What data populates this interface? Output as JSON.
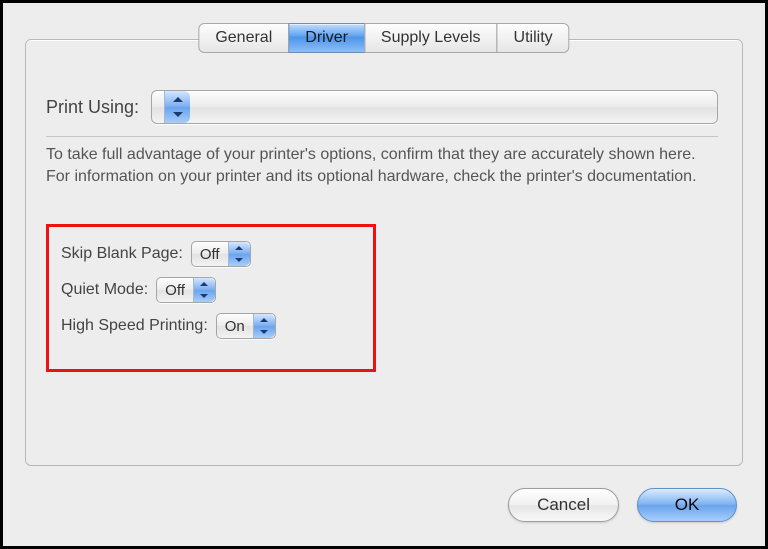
{
  "tabs": [
    {
      "label": "General",
      "active": false
    },
    {
      "label": "Driver",
      "active": true
    },
    {
      "label": "Supply Levels",
      "active": false
    },
    {
      "label": "Utility",
      "active": false
    }
  ],
  "print_using": {
    "label": "Print Using:",
    "value": ""
  },
  "help_text": "To take full advantage of your printer's options, confirm that they are accurately shown here. For information on your printer and its optional hardware, check the printer's documentation.",
  "options": {
    "skip_blank_page": {
      "label": "Skip Blank Page:",
      "value": "Off"
    },
    "quiet_mode": {
      "label": "Quiet Mode:",
      "value": "Off"
    },
    "high_speed_printing": {
      "label": "High Speed Printing:",
      "value": "On"
    }
  },
  "buttons": {
    "cancel": "Cancel",
    "ok": "OK"
  }
}
